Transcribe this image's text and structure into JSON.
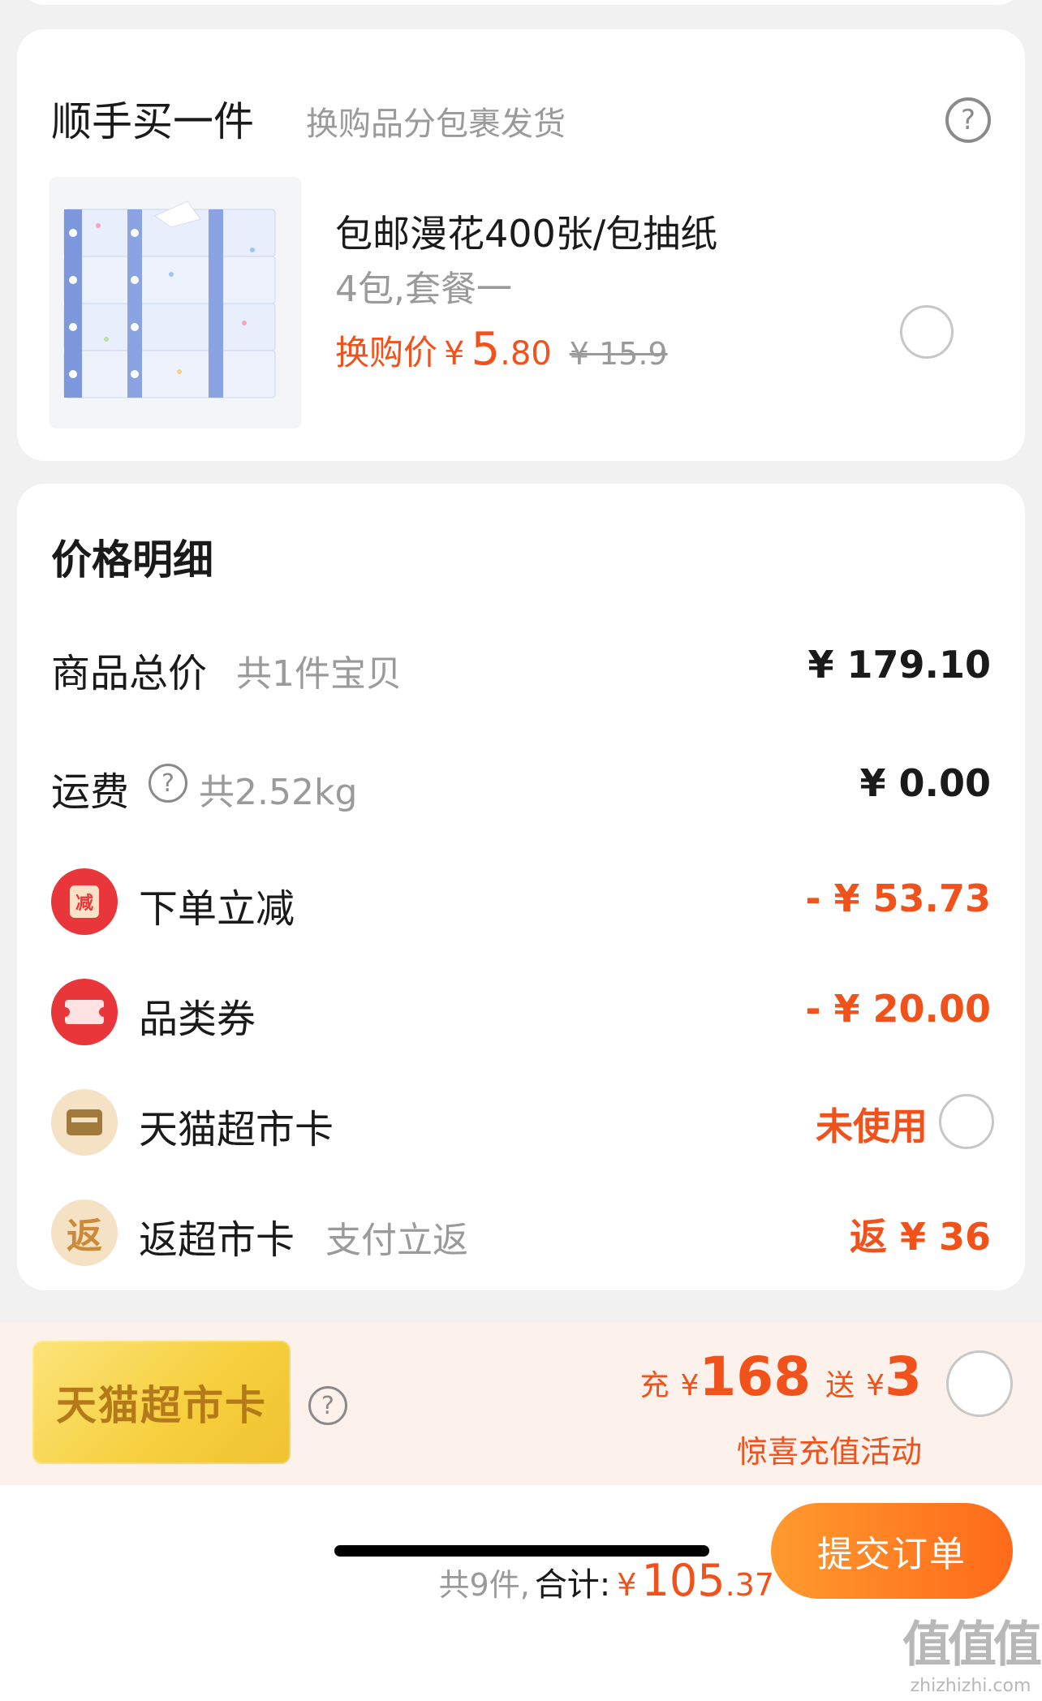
{
  "addon": {
    "title": "顺手买一件",
    "subtitle": "换购品分包裹发货",
    "help_icon": "question-circle-icon",
    "product": {
      "name": "包邮漫花400张/包抽纸",
      "spec": "4包,套餐一",
      "price_label": "换购价",
      "currency": "¥",
      "price_int": "5",
      "price_dec": ".80",
      "original_price": "¥ 15.9",
      "selected": false
    }
  },
  "price_detail": {
    "title": "价格明细",
    "rows": [
      {
        "label": "商品总价",
        "sub": "共1件宝贝",
        "value": "¥ 179.10"
      },
      {
        "label": "运费",
        "sub": "共2.52kg",
        "value": "¥ 0.00",
        "help_icon": "question-circle-icon"
      },
      {
        "label": "下单立减",
        "value": "- ¥ 53.73",
        "icon": "discount-tag-icon",
        "icon_text": "减"
      },
      {
        "label": "品类券",
        "value": "- ¥ 20.00",
        "icon": "coupon-icon"
      },
      {
        "label": "天猫超市卡",
        "value": "未使用",
        "icon": "card-icon",
        "selected": false
      },
      {
        "label": "返超市卡",
        "sub": "支付立返",
        "value": "返 ¥ 36",
        "icon": "rebate-icon",
        "icon_text": "返"
      }
    ]
  },
  "promo": {
    "card_label": "天猫超市卡",
    "charge_label": "充",
    "charge_currency": "¥",
    "charge_amount": "168",
    "gift_label": "送",
    "gift_currency": "¥",
    "gift_amount": "3",
    "activity": "惊喜充值活动",
    "selected": false
  },
  "footer": {
    "count": "共9件,",
    "total_label": "合计:",
    "currency": "¥",
    "total_int": "105",
    "total_dec": ".37",
    "submit_label": "提交订单"
  },
  "watermark": {
    "logo": "值值值",
    "site": "zhizhizhi.com"
  },
  "colors": {
    "accent": "#f1511b",
    "button_start": "#ff9a2e",
    "button_end": "#ff6a1a",
    "red_icon": "#e8363a",
    "gold_icon": "#f5e1c3",
    "promo_bg": "#fdf1ec"
  }
}
